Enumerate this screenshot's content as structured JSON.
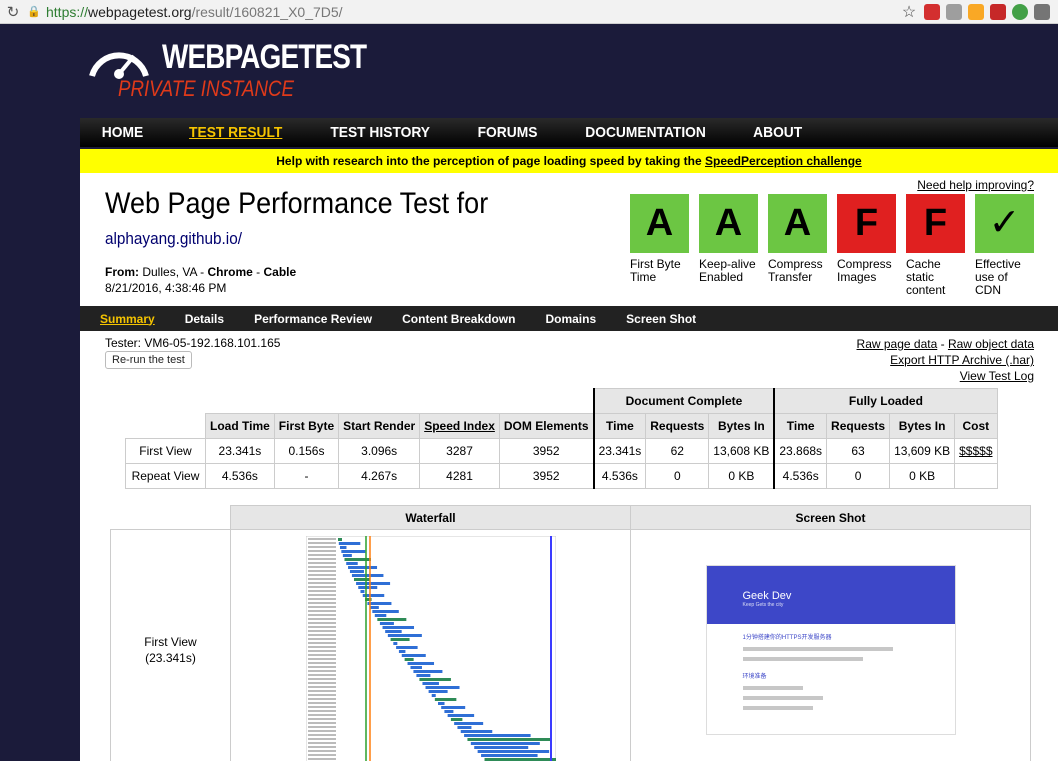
{
  "browser": {
    "url_proto": "https://",
    "url_host": "webpagetest.org",
    "url_path": "/result/160821_X0_7D5/",
    "reload_icon": "reload-icon",
    "star_icon": "bookmark-star-icon"
  },
  "logo": {
    "title": "WEBPAGETEST",
    "subtitle": "PRIVATE INSTANCE"
  },
  "main_nav": [
    "HOME",
    "TEST RESULT",
    "TEST HISTORY",
    "FORUMS",
    "DOCUMENTATION",
    "ABOUT"
  ],
  "banner": {
    "text": "Help with research into the perception of page loading speed by taking the ",
    "link": "SpeedPerception challenge"
  },
  "header": {
    "help_link": "Need help improving?",
    "title": "Web Page Performance Test for",
    "test_url": "alphayang.github.io/",
    "from_label": "From:",
    "from_location": "Dulles, VA",
    "sep1": " - ",
    "browser": "Chrome",
    "sep2": " - ",
    "connection": "Cable",
    "date": "8/21/2016, 4:38:46 PM"
  },
  "grades": [
    {
      "grade": "A",
      "label": "First Byte Time",
      "color": "#6cc643"
    },
    {
      "grade": "A",
      "label": "Keep-alive Enabled",
      "color": "#6cc643"
    },
    {
      "grade": "A",
      "label": "Compress Transfer",
      "color": "#6cc643"
    },
    {
      "grade": "F",
      "label": "Compress Images",
      "color": "#e02020"
    },
    {
      "grade": "F",
      "label": "Cache static content",
      "color": "#e02020"
    },
    {
      "grade": "✓",
      "label": "Effective use of CDN",
      "color": "#6cc643"
    }
  ],
  "sub_nav": [
    "Summary",
    "Details",
    "Performance Review",
    "Content Breakdown",
    "Domains",
    "Screen Shot"
  ],
  "tester": "Tester: VM6-05-192.168.101.165",
  "rerun": "Re-run the test",
  "links": {
    "raw_page": "Raw page data",
    "dash": " - ",
    "raw_object": "Raw object data",
    "har": "Export HTTP Archive (.har)",
    "test_log": "View Test Log"
  },
  "results": {
    "group_doc": "Document Complete",
    "group_full": "Fully Loaded",
    "columns": [
      "Load Time",
      "First Byte",
      "Start Render",
      "Speed Index",
      "DOM Elements",
      "Time",
      "Requests",
      "Bytes In",
      "Time",
      "Requests",
      "Bytes In",
      "Cost"
    ],
    "rows": [
      {
        "label": "First View",
        "cells": [
          "23.341s",
          "0.156s",
          "3.096s",
          "3287",
          "3952",
          "23.341s",
          "62",
          "13,608 KB",
          "23.868s",
          "63",
          "13,609 KB",
          "$$$$$"
        ]
      },
      {
        "label": "Repeat View",
        "cells": [
          "4.536s",
          "-",
          "4.267s",
          "4281",
          "3952",
          "4.536s",
          "0",
          "0 KB",
          "4.536s",
          "0",
          "0 KB",
          ""
        ]
      }
    ]
  },
  "waterfall": {
    "col1": "Waterfall",
    "col2": "Screen Shot",
    "row_label": "First View",
    "row_time": "(23.341s)",
    "shot_title": "Geek Dev",
    "shot_sub": "Keep Gets the city",
    "shot_heading": "1分钟搭建你的HTTPS开发服务器",
    "shot_section": "环境准备"
  }
}
